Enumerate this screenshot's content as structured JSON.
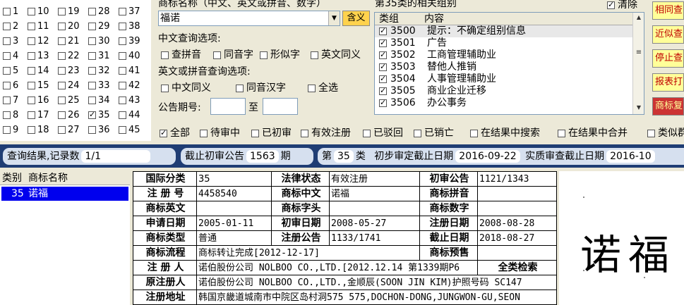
{
  "class_grid": [
    [
      "1",
      "10",
      "19",
      "28",
      "37"
    ],
    [
      "2",
      "11",
      "20",
      "29",
      "38"
    ],
    [
      "3",
      "12",
      "21",
      "30",
      "39"
    ],
    [
      "4",
      "13",
      "22",
      "31",
      "40"
    ],
    [
      "5",
      "14",
      "23",
      "32",
      "41"
    ],
    [
      "6",
      "15",
      "24",
      "33",
      "42"
    ],
    [
      "7",
      "16",
      "25",
      "34",
      "43"
    ],
    [
      "8",
      "17",
      "26",
      "35",
      "44"
    ],
    [
      "9",
      "18",
      "27",
      "36",
      "45"
    ]
  ],
  "class_grid_checked": [
    "35"
  ],
  "search": {
    "name_label": "商标名称（中文、英文或拼音、数字）",
    "name_value": "福诺",
    "synonym_button": "含义",
    "cn_options_label": "中文查询选项:",
    "cn_options": [
      "查拼音",
      "同音字",
      "形似字",
      "英文同义"
    ],
    "en_options_label": "英文或拼音查询选项:",
    "en_options": [
      "中文同义",
      "同音汉字",
      "全选"
    ],
    "issue_label": "公告期号:",
    "issue_to": "至"
  },
  "groups": {
    "title": "第35类的相关组别",
    "clear_label": "清除",
    "col_group": "类组",
    "col_content": "内容",
    "rows": [
      {
        "code": "3500",
        "desc": "提示：不确定组别信息"
      },
      {
        "code": "3501",
        "desc": "广告"
      },
      {
        "code": "3502",
        "desc": "工商管理辅助业"
      },
      {
        "code": "3503",
        "desc": "替他人推销"
      },
      {
        "code": "3504",
        "desc": "人事管理辅助业"
      },
      {
        "code": "3505",
        "desc": "商业企业迁移"
      },
      {
        "code": "3506",
        "desc": "办公事务"
      }
    ]
  },
  "right_buttons": [
    "相同查",
    "近似查",
    "停止查",
    "报表打",
    "商标复"
  ],
  "filters": [
    "全部",
    "待审中",
    "已初审",
    "有效注册",
    "已驳回",
    "已销亡",
    "在结果中搜索",
    "在结果中合并",
    "类似群"
  ],
  "filters_checked": [
    "全部"
  ],
  "status": {
    "result_label": "查询结果,记录数",
    "result_count": "1/1",
    "cutoff_label": "截止初审公告",
    "cutoff_value": "1563",
    "cutoff_unit": "期",
    "class_prefix": "第",
    "class_value": "35",
    "class_suffix": "类",
    "prelim_label": "初步审定截止日期",
    "prelim_date": "2016-09-22",
    "exam_label": "实质审查截止日期",
    "exam_date": "2016-10"
  },
  "result_list": {
    "col_class": "类别",
    "col_name": "商标名称",
    "rows": [
      {
        "class": "35",
        "name": "诺福"
      }
    ]
  },
  "detail": {
    "r1": [
      "国际分类",
      "35",
      "法律状态",
      "有效注册",
      "初审公告",
      "1121/1343"
    ],
    "r2": [
      "注 册 号",
      "4458540",
      "商标中文",
      "诺福",
      "商标拼音",
      ""
    ],
    "r3": [
      "商标英文",
      "",
      "商标字头",
      "",
      "商标数字",
      ""
    ],
    "r4": [
      "申请日期",
      "2005-01-11",
      "初审日期",
      "2008-05-27",
      "注册日期",
      "2008-08-28"
    ],
    "r5": [
      "商标类型",
      "普通",
      "注册公告",
      "1133/1741",
      "截止日期",
      "2018-08-27"
    ],
    "r6": [
      "商标流程",
      "商标转让完成[2012-12-17]",
      "商标预售",
      ""
    ],
    "r7": [
      "注 册 人",
      "诺伯股份公司 NOLBOO CO.,LTD.[2012.12.14 第1339期P6",
      "全类检索"
    ],
    "r8": [
      "原注册人",
      "诺伯股份公司 NOLBOO CO.,LTD.,金顺辰(SOON JIN KIM)护照号码 SC147"
    ],
    "r9": [
      "注册地址",
      "韩国京畿道城南市中院区岛村洞575 575,DOCHON-DONG,JUNGWON-GU,SEON"
    ]
  },
  "preview_text": "诺福"
}
